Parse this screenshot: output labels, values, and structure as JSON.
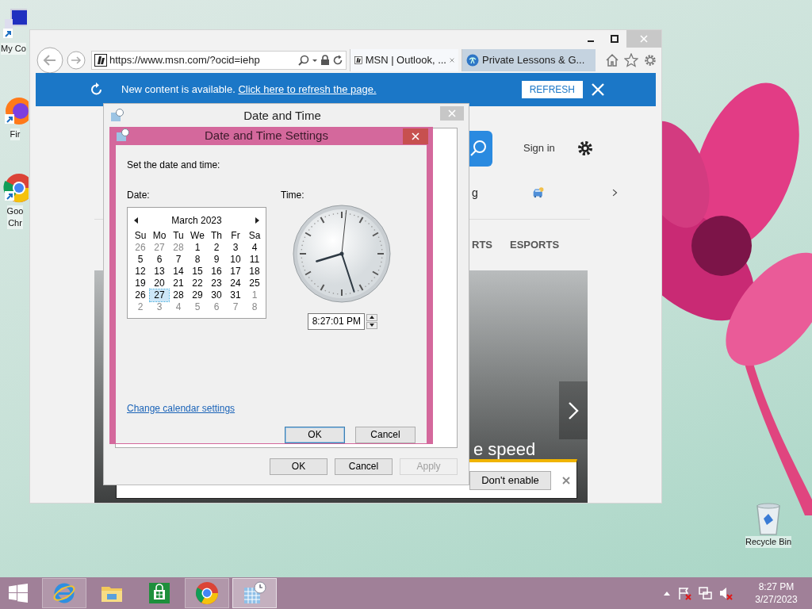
{
  "desktop_icons": [
    {
      "kind": "computer",
      "lines": [
        "My Co"
      ]
    },
    {
      "kind": "firefox",
      "lines": [
        "Fir"
      ]
    },
    {
      "kind": "chrome",
      "lines": [
        "Goo",
        "Chr"
      ]
    },
    {
      "kind": "recycle-bin",
      "lines": [
        "Recycle Bin"
      ]
    }
  ],
  "browser": {
    "address": "https://www.msn.com/?ocid=iehp",
    "tabs": [
      {
        "label": "MSN | Outlook, ...",
        "selected": true
      },
      {
        "label": "Private Lessons & G...",
        "selected": false
      }
    ],
    "notification": {
      "message": "New content is available. ",
      "link": "Click here to refresh the page.",
      "button": "REFRESH"
    },
    "page": {
      "sign_in": "Sign in",
      "row_text": "g",
      "categories": [
        "RTS",
        "ESPORTS"
      ],
      "headline": "e speed"
    },
    "prompt": {
      "button": "Don't enable"
    }
  },
  "date_time_dialog": {
    "title": "Date and Time",
    "buttons": [
      {
        "label": "OK",
        "disabled": false
      },
      {
        "label": "Cancel",
        "disabled": false
      },
      {
        "label": "Apply",
        "disabled": true
      }
    ]
  },
  "settings_dialog": {
    "title": "Date and Time Settings",
    "instruction": "Set the date and time:",
    "date_label": "Date:",
    "time_label": "Time:",
    "calendar": {
      "month": "March 2023",
      "weekdays": [
        "Su",
        "Mo",
        "Tu",
        "We",
        "Th",
        "Fr",
        "Sa"
      ],
      "weeks": [
        [
          {
            "day": "26",
            "other_month": true,
            "selected": false
          },
          {
            "day": "27",
            "other_month": true,
            "selected": false
          },
          {
            "day": "28",
            "other_month": true,
            "selected": false
          },
          {
            "day": "1",
            "other_month": false,
            "selected": false
          },
          {
            "day": "2",
            "other_month": false,
            "selected": false
          },
          {
            "day": "3",
            "other_month": false,
            "selected": false
          },
          {
            "day": "4",
            "other_month": false,
            "selected": false
          }
        ],
        [
          {
            "day": "5",
            "other_month": false,
            "selected": false
          },
          {
            "day": "6",
            "other_month": false,
            "selected": false
          },
          {
            "day": "7",
            "other_month": false,
            "selected": false
          },
          {
            "day": "8",
            "other_month": false,
            "selected": false
          },
          {
            "day": "9",
            "other_month": false,
            "selected": false
          },
          {
            "day": "10",
            "other_month": false,
            "selected": false
          },
          {
            "day": "11",
            "other_month": false,
            "selected": false
          }
        ],
        [
          {
            "day": "12",
            "other_month": false,
            "selected": false
          },
          {
            "day": "13",
            "other_month": false,
            "selected": false
          },
          {
            "day": "14",
            "other_month": false,
            "selected": false
          },
          {
            "day": "15",
            "other_month": false,
            "selected": false
          },
          {
            "day": "16",
            "other_month": false,
            "selected": false
          },
          {
            "day": "17",
            "other_month": false,
            "selected": false
          },
          {
            "day": "18",
            "other_month": false,
            "selected": false
          }
        ],
        [
          {
            "day": "19",
            "other_month": false,
            "selected": false
          },
          {
            "day": "20",
            "other_month": false,
            "selected": false
          },
          {
            "day": "21",
            "other_month": false,
            "selected": false
          },
          {
            "day": "22",
            "other_month": false,
            "selected": false
          },
          {
            "day": "23",
            "other_month": false,
            "selected": false
          },
          {
            "day": "24",
            "other_month": false,
            "selected": false
          },
          {
            "day": "25",
            "other_month": false,
            "selected": false
          }
        ],
        [
          {
            "day": "26",
            "other_month": false,
            "selected": false
          },
          {
            "day": "27",
            "other_month": false,
            "selected": true
          },
          {
            "day": "28",
            "other_month": false,
            "selected": false
          },
          {
            "day": "29",
            "other_month": false,
            "selected": false
          },
          {
            "day": "30",
            "other_month": false,
            "selected": false
          },
          {
            "day": "31",
            "other_month": false,
            "selected": false
          },
          {
            "day": "1",
            "other_month": true,
            "selected": false
          }
        ],
        [
          {
            "day": "2",
            "other_month": true,
            "selected": false
          },
          {
            "day": "3",
            "other_month": true,
            "selected": false
          },
          {
            "day": "4",
            "other_month": true,
            "selected": false
          },
          {
            "day": "5",
            "other_month": true,
            "selected": false
          },
          {
            "day": "6",
            "other_month": true,
            "selected": false
          },
          {
            "day": "7",
            "other_month": true,
            "selected": false
          },
          {
            "day": "8",
            "other_month": true,
            "selected": false
          }
        ]
      ]
    },
    "time_value": "8:27:01 PM",
    "link": "Change calendar settings",
    "buttons": [
      {
        "label": "OK",
        "default": true
      },
      {
        "label": "Cancel",
        "default": false
      }
    ]
  },
  "taskbar": {
    "apps": [
      {
        "kind": "ie",
        "running": true,
        "selected": false
      },
      {
        "kind": "explorer",
        "running": false,
        "selected": false
      },
      {
        "kind": "store",
        "running": false,
        "selected": false
      },
      {
        "kind": "chrome",
        "running": true,
        "selected": false
      },
      {
        "kind": "datetime",
        "running": true,
        "selected": true
      }
    ],
    "tray": [
      {
        "kind": "arrow"
      },
      {
        "kind": "flag",
        "alert": true
      },
      {
        "kind": "network"
      },
      {
        "kind": "volume",
        "muted": true
      }
    ],
    "clock": {
      "time": "8:27 PM",
      "date": "3/27/2023"
    }
  }
}
